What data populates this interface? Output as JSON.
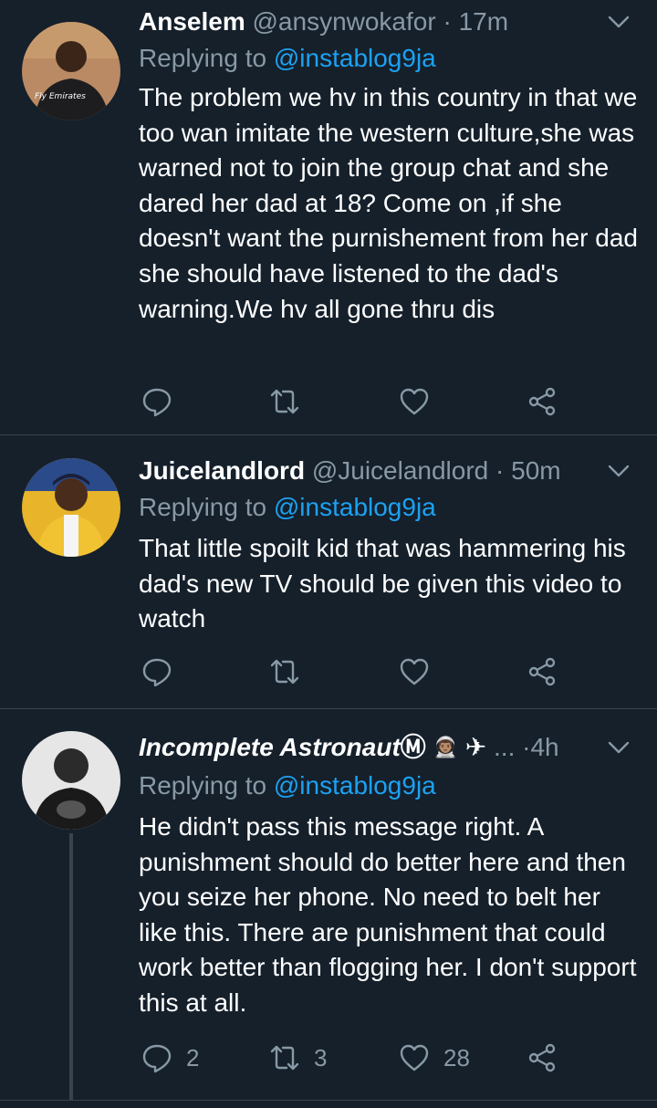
{
  "tweets": [
    {
      "name": "Anselem",
      "handle": "@ansynwokafor",
      "dot": "·",
      "time": "17m",
      "replying_label": "Replying to",
      "replying_to": "@instablog9ja",
      "text": "The problem we hv in this country in that we too wan imitate the western culture,she was warned not to join the group chat and she dared her dad at 18? Come on ,if she doesn't want the purnishement from her dad she should have listened to the dad's warning.We hv all gone thru dis",
      "avatar_text": "Fly Emirates",
      "replies": "",
      "retweets": "",
      "likes": ""
    },
    {
      "name": "Juicelandlord",
      "handle": "@Juicelandlord",
      "dot": "·",
      "time": "50m",
      "replying_label": "Replying to",
      "replying_to": "@instablog9ja",
      "text": "That little spoilt kid that was hammering his dad's new TV should be given this video to watch",
      "replies": "",
      "retweets": "",
      "likes": ""
    },
    {
      "name": "Incomplete Astronaut",
      "name_badge": "Ⓜ",
      "emoji_astronaut": "👨🏽‍🚀",
      "emoji_plane": "✈",
      "ellipsis": "...",
      "dot": "·",
      "time": "4h",
      "replying_label": "Replying to",
      "replying_to": "@instablog9ja",
      "text": "He didn't pass this message right. A punishment should do better here and then you seize her phone. No need to belt her like this. There are punishment that could work better than flogging her. I don't support this at all.",
      "replies": "2",
      "retweets": "3",
      "likes": "28"
    }
  ],
  "colors": {
    "background": "#15202b",
    "secondary_text": "#8899a6",
    "mention": "#1da1f2",
    "divider": "#38444d"
  },
  "icons": {
    "reply": "reply-icon",
    "retweet": "retweet-icon",
    "like": "heart-icon",
    "share": "share-icon",
    "menu": "chevron-down-icon"
  }
}
